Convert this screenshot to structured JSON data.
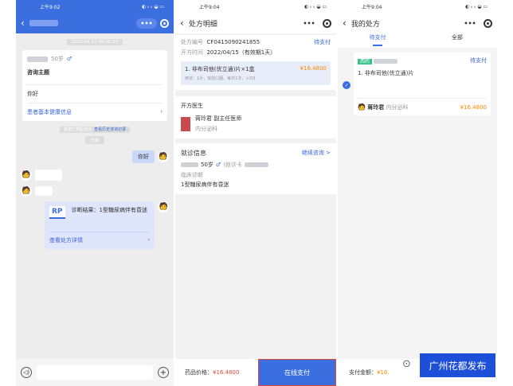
{
  "colors": {
    "blue": "#3b6fe0",
    "orange": "#ff8a00",
    "green": "#35c28a"
  },
  "p1": {
    "time": "上午9:02",
    "signal": "◐ ᵢₗ ᵢₗ ◒ ▭",
    "timestamp": "2022-04-15 09:08:15",
    "age": "50岁",
    "gender": "♂",
    "topic_label": "咨询主题",
    "topic_value": "你好",
    "health_info": "患者基本健康信息",
    "notice_a": "患者已发起咨询 ·",
    "notice_b": "查看历史咨询记录",
    "badge": "已结",
    "msg_hello": "你好",
    "rx_badge": "RP",
    "rx_diag": "诊断结果：1型糖尿病伴有昏迷",
    "rx_link": "查看处方详情",
    "voice_icon": "voice-icon",
    "add_icon": "plus-icon"
  },
  "p2": {
    "time": "上午9:04",
    "signal": "◐ ᵢₗ ᵢₗ ◒ ▭",
    "title": "处方明细",
    "no_label": "处方编号",
    "no_value": "CF0415090241855",
    "status": "待支付",
    "date_label": "开方时间",
    "date_value": "2022/04/15（有效期1天）",
    "drug": "1. 非布司他(优立通)片×1盒",
    "drug_price": "¥16.4800",
    "usage": "用法：1片，饭前口服，每日1次，×3日",
    "doc_section": "开方医生",
    "doc_name": "蒋玲君  副主任医师",
    "doc_dept": "内分泌科",
    "visit_section": "就诊信息",
    "visit_more": "继续咨询 >",
    "visit_age": "50岁",
    "visit_gender": "♂",
    "visit_card": "(就诊卡",
    "diag_label": "临床诊断",
    "diag_value": "1型糖尿病伴有昏迷",
    "total_label": "药品价格：",
    "total_value": "¥16.4800",
    "pay_btn": "在线支付"
  },
  "p3": {
    "time": "上午9:04",
    "signal": "◐ ᵢₗ ᵢₗ ◒ ▭",
    "title": "我的处方",
    "tab_pending": "待支付",
    "tab_all": "全部",
    "tag": "西药",
    "status": "待支付",
    "drug": "1. 非布司他(优立通)片",
    "doctor": "蒋玲君",
    "dept": "内分泌科",
    "price": "¥16.4800",
    "pay_label": "支付金额：",
    "pay_value": "¥16.",
    "watermark": "广州花都发布"
  }
}
